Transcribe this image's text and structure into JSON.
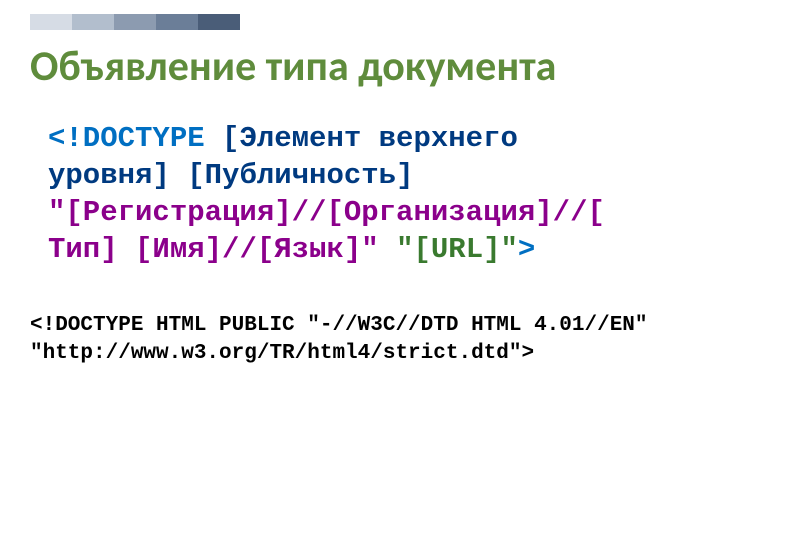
{
  "accent_colors": [
    "#d6dce5",
    "#b2becd",
    "#8c9bb0",
    "#6b7e98",
    "#4a5d78"
  ],
  "title": "Объявление типа документа",
  "syntax": {
    "lt_doctype": "<!DOCTYPE ",
    "top1": "[Элемент верхнего",
    "top2": "уровня]",
    "sp1": " ",
    "publicity": "[Публичность]",
    "sp2": " ",
    "q1": "\"",
    "reg_org": "[Регистрация]//[Организация]//[",
    "type_close": "Тип]",
    "sp3": " ",
    "name_lang": "[Имя]//[Язык]",
    "q2": "\"",
    "sp4": " ",
    "url": "\"[URL]\"",
    "gt": ">"
  },
  "example": {
    "line1": "<!DOCTYPE HTML PUBLIC \"-//W3C//DTD HTML 4.01//EN\"",
    "line2": "\"http://www.w3.org/TR/html4/strict.dtd\">"
  }
}
